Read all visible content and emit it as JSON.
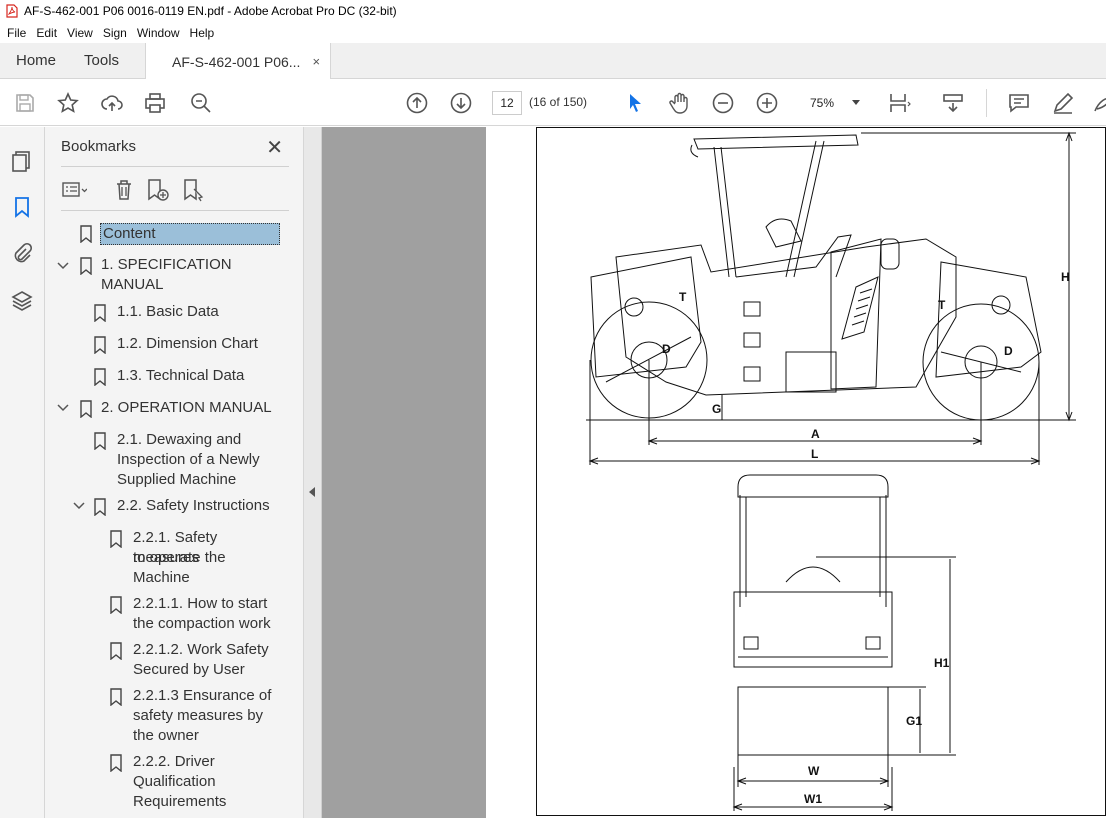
{
  "window": {
    "title": "AF-S-462-001 P06 0016-0119 EN.pdf - Adobe Acrobat Pro DC (32-bit)"
  },
  "menu": [
    "File",
    "Edit",
    "View",
    "Sign",
    "Window",
    "Help"
  ],
  "tabs": {
    "home": "Home",
    "tools": "Tools",
    "doc": "AF-S-462-001 P06...",
    "close": "×"
  },
  "toolbar": {
    "page_number": "12",
    "page_count": "(16 of 150)",
    "zoom": "75%"
  },
  "bookmarks": {
    "title": "Bookmarks",
    "close": "✕",
    "items": [
      {
        "label": "Content",
        "selected": true
      },
      {
        "label": "1. SPECIFICATION MANUAL",
        "line1": "1. SPECIFICATION",
        "line2": "MANUAL",
        "expanded": true
      },
      {
        "label": "1.1. Basic Data"
      },
      {
        "label": "1.2. Dimension Chart"
      },
      {
        "label": "1.3. Technical Data"
      },
      {
        "label": "2. OPERATION MANUAL",
        "expanded": true
      },
      {
        "line1": "2.1. Dewaxing and",
        "line2": "Inspection of a Newly",
        "line3": "Supplied Machine"
      },
      {
        "label": "2.2. Safety Instructions",
        "expanded": true
      },
      {
        "line1": "2.2.1. Safety measures",
        "line2": "to operate the",
        "line3": "Machine"
      },
      {
        "line1": "2.2.1.1. How to start",
        "line2": "the compaction work"
      },
      {
        "line1": "2.2.1.2. Work Safety",
        "line2": "Secured by User"
      },
      {
        "line1": "2.2.1.3 Ensurance of",
        "line2": "safety measures by",
        "line3": "the owner"
      },
      {
        "line1": "2.2.2. Driver",
        "line2": "Qualification",
        "line3": "Requirements"
      }
    ]
  },
  "drawing": {
    "labels": {
      "H": "H",
      "A": "A",
      "L": "L",
      "G": "G",
      "T": "T",
      "D": "D",
      "H1": "H1",
      "G1": "G1",
      "W": "W",
      "W1": "W1"
    }
  },
  "colors": {
    "accent": "#1473e6",
    "selection": "#9bbfd9",
    "doc_bg": "#a0a0a0",
    "pdf_red": "#d7261e"
  }
}
